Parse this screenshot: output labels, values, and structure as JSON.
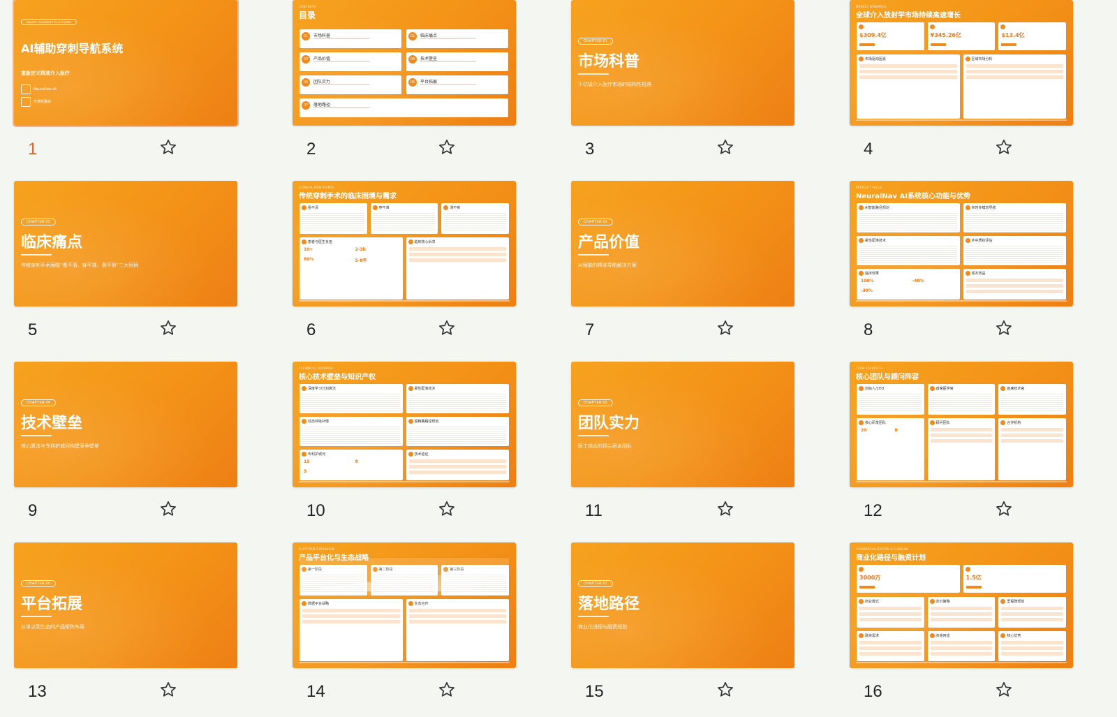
{
  "colors": {
    "accent": "#f39217",
    "selected_number": "#d8632b",
    "background": "#f3f6f1"
  },
  "selected_slide": 1,
  "slides": [
    {
      "number": "1",
      "kind": "cover",
      "tag": "SMART SURGERY PLATFORM",
      "title": "AI辅助穿刺导航系统",
      "subtitle": "重新定义精准介入医疗",
      "items": [
        "NeuralNav-AI",
        "天使轮融资"
      ]
    },
    {
      "number": "2",
      "kind": "toc",
      "kicker": "CONTENTS",
      "title": "目录",
      "entries": [
        {
          "n": "01",
          "label": "市场科普"
        },
        {
          "n": "02",
          "label": "临床痛点"
        },
        {
          "n": "03",
          "label": "产品价值"
        },
        {
          "n": "04",
          "label": "技术壁垒"
        },
        {
          "n": "05",
          "label": "团队实力"
        },
        {
          "n": "06",
          "label": "平台拓展"
        },
        {
          "n": "07",
          "label": "落地路径"
        }
      ]
    },
    {
      "number": "3",
      "kind": "chapter",
      "chip": "CHAPTER 01",
      "title": "市场科普",
      "subtitle": "千亿级介入医疗市场的结构性机遇"
    },
    {
      "number": "4",
      "kind": "content",
      "kicker": "MARKET DYNAMICS",
      "title": "全球介入放射学市场持续高速增长",
      "metrics": [
        "$309.4亿",
        "¥345.26亿",
        "$13.4亿"
      ],
      "sections": [
        "市场驱动因素",
        "区域市场分析"
      ]
    },
    {
      "number": "5",
      "kind": "chapter",
      "chip": "CHAPTER 02",
      "title": "临床痛点",
      "subtitle": "传统穿刺手术面临“看不清、穿不准、测不到”三大困境"
    },
    {
      "number": "6",
      "kind": "content",
      "kicker": "CLINICAL PAIN POINTS",
      "title": "传统穿刺手术的临床困境与需求",
      "cards": [
        "看不清",
        "穿不准",
        "测不到"
      ],
      "metrics": [
        "10+",
        "2-3h",
        "80%",
        "5-8年"
      ],
      "sections": [
        "患者与医生负担",
        "临床核心诉求"
      ]
    },
    {
      "number": "7",
      "kind": "chapter",
      "chip": "CHAPTER 03",
      "title": "产品价值",
      "subtitle": "AI赋能的精准导航解决方案"
    },
    {
      "number": "8",
      "kind": "content",
      "kicker": "PRODUCT VALUE",
      "title": "NeuralNav AI系统核心功能与优势",
      "cards": [
        "AI智能路径规划",
        "实时多模态导航",
        "柔性配准技术",
        "术中质控评估"
      ],
      "metrics": [
        "100%",
        "-40%",
        "-30%"
      ],
      "sections": [
        "临床效果",
        "成本效益"
      ]
    },
    {
      "number": "9",
      "kind": "chapter",
      "chip": "CHAPTER 04",
      "title": "技术壁垒",
      "subtitle": "核心算法与专利护城河构建竞争壁垒"
    },
    {
      "number": "10",
      "kind": "content",
      "kicker": "TECHNICAL BARRIERS",
      "title": "核心技术壁垒与知识产权",
      "cards": [
        "深度学习分割算法",
        "柔性配准技术",
        "动态呼吸补偿",
        "超精确路径规划"
      ],
      "metrics": [
        "15",
        "8",
        "5"
      ],
      "sections": [
        "专利护城河",
        "技术验证"
      ]
    },
    {
      "number": "11",
      "kind": "chapter",
      "chip": "CHAPTER 05",
      "title": "团队实力",
      "subtitle": "医工结合的顶尖研发团队"
    },
    {
      "number": "12",
      "kind": "content",
      "kicker": "TEAM STRENGTH",
      "title": "核心团队与顾问阵容",
      "cards": [
        "创始人/CEO",
        "首席医学官",
        "首席技术官"
      ],
      "metrics": [
        "20",
        "8"
      ],
      "sections": [
        "核心研发团队",
        "顾问团队",
        "合作机构"
      ]
    },
    {
      "number": "13",
      "kind": "chapter",
      "chip": "CHAPTER 06",
      "title": "平台拓展",
      "subtitle": "从单点到生态的产品矩阵布局"
    },
    {
      "number": "14",
      "kind": "content",
      "kicker": "PLATFORM EXPANSION",
      "title": "产品平台化与生态战略",
      "cards": [
        "第一阶段",
        "第二阶段",
        "第三阶段"
      ],
      "sections": [
        "数据平台战略",
        "生态合作"
      ]
    },
    {
      "number": "15",
      "kind": "chapter",
      "chip": "CHAPTER 07",
      "title": "落地路径",
      "subtitle": "商业化进程与融资规划"
    },
    {
      "number": "16",
      "kind": "content",
      "kicker": "COMMERCIALIZATION & FUNDING",
      "title": "商业化路径与融资计划",
      "metrics": [
        "3000万",
        "1.5亿"
      ],
      "sections": [
        "商业模式",
        "定价策略",
        "里程碑规划",
        "融资需求",
        "资金用途",
        "核心优势"
      ]
    }
  ]
}
